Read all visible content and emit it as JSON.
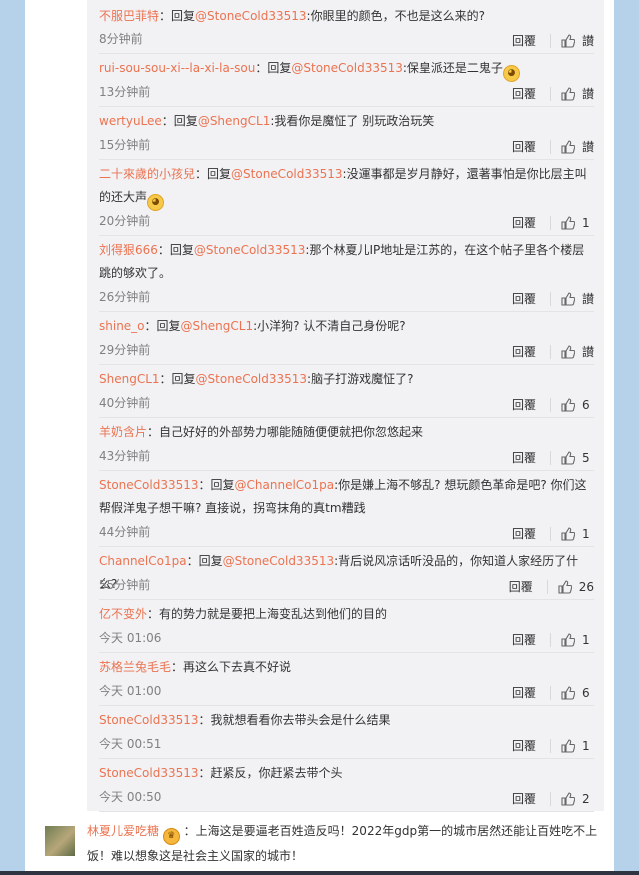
{
  "replies": [
    {
      "user": "不服巴菲特",
      "prefix": "：回复",
      "mention": "@StoneCold33513",
      "body": ":你眼里的颜色，不也是这么来的?",
      "emoji": "",
      "time": "8分钟前",
      "reply": "回覆",
      "likes": "讃"
    },
    {
      "user": "rui-sou-sou-xi--la-xi-la-sou",
      "prefix": "：回复",
      "mention": "@StoneCold33513",
      "body": ":保皇派还是二鬼子",
      "emoji": "smirk-emoji",
      "time": "13分钟前",
      "reply": "回覆",
      "likes": "讃"
    },
    {
      "user": "wertyuLee",
      "prefix": "：回复",
      "mention": "@ShengCL1",
      "body": ":我看你是魔怔了 别玩政治玩笑",
      "emoji": "",
      "time": "15分钟前",
      "reply": "回覆",
      "likes": "讃"
    },
    {
      "user": "二十來歲的小孩兒",
      "prefix": "：回复",
      "mention": "@StoneCold33513",
      "body": ":没運事都是岁月静好，還著事怕是你比层主叫的还大声",
      "emoji": "smirk-emoji",
      "time": "20分钟前",
      "reply": "回覆",
      "likes": "1"
    },
    {
      "user": "刘得狠666",
      "prefix": "：回复",
      "mention": "@StoneCold33513",
      "body": ":那个林夏儿IP地址是江苏的，在这个帖子里各个楼层跳的够欢了。",
      "emoji": "",
      "time": "26分钟前",
      "reply": "回覆",
      "likes": "讃"
    },
    {
      "user": "shine_o",
      "prefix": "：回复",
      "mention": "@ShengCL1",
      "body": ":小洋狗? 认不清自己身份呢?",
      "emoji": "",
      "time": "29分钟前",
      "reply": "回覆",
      "likes": "讃"
    },
    {
      "user": "ShengCL1",
      "prefix": "：回复",
      "mention": "@StoneCold33513",
      "body": ":脑子打游戏魔怔了?",
      "emoji": "",
      "time": "40分钟前",
      "reply": "回覆",
      "likes": "6"
    },
    {
      "user": "羊奶含片",
      "prefix": "：",
      "mention": "",
      "body": "自己好好的外部势力哪能随随便便就把你忽悠起来",
      "emoji": "",
      "time": "43分钟前",
      "reply": "回覆",
      "likes": "5"
    },
    {
      "user": "StoneCold33513",
      "prefix": "：回复",
      "mention": "@ChannelCo1pa",
      "body": ":你是嫌上海不够乱? 想玩颜色革命是吧? 你们这帮假洋鬼子想干嘛? 直接说，拐弯抹角的真tm糟践",
      "emoji": "",
      "time": "44分钟前",
      "reply": "回覆",
      "likes": "1"
    },
    {
      "user": "ChannelCo1pa",
      "prefix": "：回复",
      "mention": "@StoneCold33513",
      "body": ":背后说风凉话听没品的，你知道人家经历了什么?",
      "emoji": "",
      "time": "55分钟前",
      "reply": "回覆",
      "likes": "26"
    },
    {
      "user": "亿不变外",
      "prefix": "：",
      "mention": "",
      "body": "有的势力就是要把上海变乱达到他们的目的",
      "emoji": "",
      "time": "今天 01:06",
      "reply": "回覆",
      "likes": "1"
    },
    {
      "user": "苏格兰兔毛毛",
      "prefix": "：",
      "mention": "",
      "body": "再这么下去真不好说",
      "emoji": "",
      "time": "今天 01:00",
      "reply": "回覆",
      "likes": "6"
    },
    {
      "user": "StoneCold33513",
      "prefix": "：",
      "mention": "",
      "body": "我就想看看你去带头会是什么结果",
      "emoji": "",
      "time": "今天 00:51",
      "reply": "回覆",
      "likes": "1"
    },
    {
      "user": "StoneCold33513",
      "prefix": "：",
      "mention": "",
      "body": "赶紧反，你赶紧去带个头",
      "emoji": "",
      "time": "今天 00:50",
      "reply": "回覆",
      "likes": "2"
    }
  ],
  "main_comment": {
    "user": "林夏儿爱吃糖",
    "badge": "crown-badge-icon",
    "body": "：上海这是要逼老百姓造反吗！2022年gdp第一的城市居然还能让百姓吃不上饭！难以想象这是社会主义国家的城市！"
  },
  "colors": {
    "username": "#eb7350",
    "background": "#b5d2ea",
    "reply_box": "#f2f2f5"
  }
}
